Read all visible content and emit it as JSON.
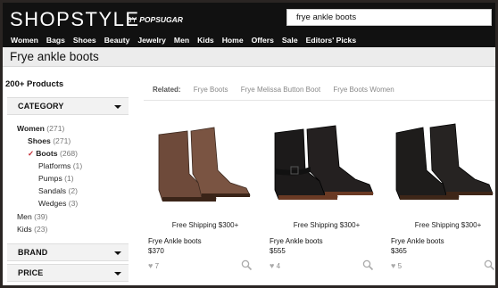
{
  "header": {
    "logo": "SHOPSTYLE",
    "logo_by": "BY",
    "logo_partner": "POPSUGAR",
    "search_value": "frye ankle boots"
  },
  "nav": [
    "Women",
    "Bags",
    "Shoes",
    "Beauty",
    "Jewelry",
    "Men",
    "Kids",
    "Home",
    "Offers",
    "Sale",
    "Editors' Picks"
  ],
  "page": {
    "title": "Frye ankle boots"
  },
  "sidebar": {
    "count": "200+ Products",
    "facets": {
      "category": "CATEGORY",
      "brand": "BRAND",
      "price": "PRICE"
    },
    "tree": {
      "women": {
        "label": "Women",
        "count": "(271)"
      },
      "shoes": {
        "label": "Shoes",
        "count": "(271)"
      },
      "boots": {
        "check": "✓",
        "label": "Boots",
        "count": "(268)"
      },
      "platforms": {
        "label": "Platforms",
        "count": "(1)"
      },
      "pumps": {
        "label": "Pumps",
        "count": "(1)"
      },
      "sandals": {
        "label": "Sandals",
        "count": "(2)"
      },
      "wedges": {
        "label": "Wedges",
        "count": "(3)"
      },
      "men": {
        "label": "Men",
        "count": "(39)"
      },
      "kids": {
        "label": "Kids",
        "count": "(23)"
      }
    }
  },
  "related": {
    "label": "Related:",
    "links": [
      "Frye Boots",
      "Frye Melissa Button Boot",
      "Frye Boots Women"
    ]
  },
  "products": [
    {
      "shipping": "Free Shipping $300+",
      "name": "Frye Ankle boots",
      "price": "$370",
      "favorites": "7",
      "color": "#6e4a3a"
    },
    {
      "shipping": "Free Shipping $300+",
      "name": "Frye Ankle boots",
      "price": "$555",
      "favorites": "4",
      "color": "#1c1a1a"
    },
    {
      "shipping": "Free Shipping $300+",
      "name": "Frye Ankle boots",
      "price": "$365",
      "favorites": "5",
      "color": "#1e1c1b"
    }
  ],
  "icons": {
    "heart": "heart-icon",
    "zoom": "magnifier-icon",
    "caret": "caret-down-icon",
    "check": "checkmark-icon"
  }
}
